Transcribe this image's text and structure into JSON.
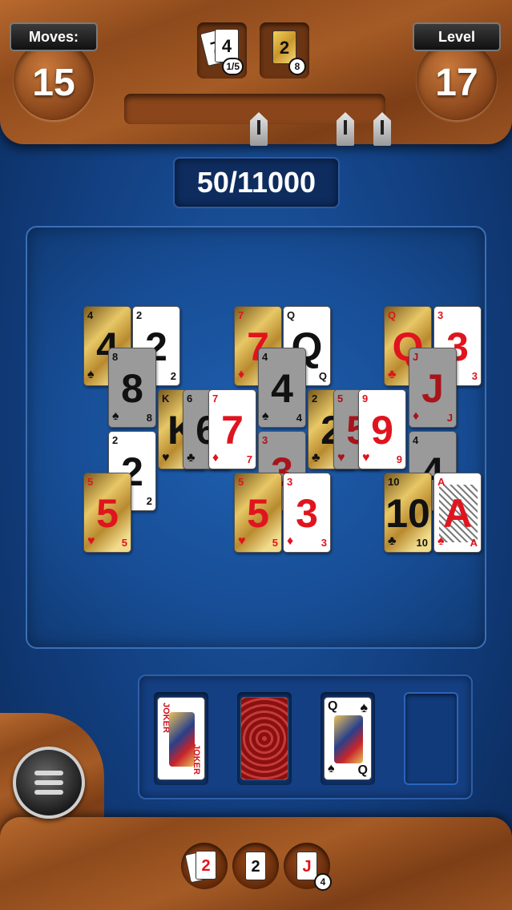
{
  "header": {
    "moves_label": "Moves:",
    "moves_value": "15",
    "level_label": "Level",
    "level_value": "17",
    "combo_card_rank": "4",
    "combo_progress": "1/5",
    "joker_card_rank": "2",
    "joker_count": "8"
  },
  "score": "50/11000",
  "board": {
    "cards": [
      {
        "rank": "4",
        "suit": "♠",
        "style": "gold",
        "color": "black"
      },
      {
        "rank": "2",
        "suit": "♣",
        "style": "face-up",
        "color": "black"
      },
      {
        "rank": "8",
        "suit": "♠",
        "style": "dim",
        "color": "black"
      },
      {
        "rank": "K",
        "suit": "♥",
        "style": "gold",
        "color": "black"
      },
      {
        "rank": "6",
        "suit": "♣",
        "style": "dim",
        "color": "black"
      },
      {
        "rank": "7",
        "suit": "♦",
        "style": "face-up",
        "color": "red"
      },
      {
        "rank": "2",
        "suit": "♣",
        "style": "face-up",
        "color": "black"
      },
      {
        "rank": "5",
        "suit": "♥",
        "style": "gold",
        "color": "red"
      },
      {
        "rank": "7",
        "suit": "♦",
        "style": "gold",
        "color": "red"
      },
      {
        "rank": "Q",
        "suit": "♠",
        "style": "face-up",
        "color": "black"
      },
      {
        "rank": "4",
        "suit": "♠",
        "style": "dim",
        "color": "black"
      },
      {
        "rank": "2",
        "suit": "♣",
        "style": "gold",
        "color": "black"
      },
      {
        "rank": "3",
        "suit": "♦",
        "style": "dim",
        "color": "red"
      },
      {
        "rank": "5",
        "suit": "♥",
        "style": "dim",
        "color": "red"
      },
      {
        "rank": "9",
        "suit": "♥",
        "style": "face-up",
        "color": "red"
      },
      {
        "rank": "5",
        "suit": "♥",
        "style": "gold",
        "color": "red"
      },
      {
        "rank": "3",
        "suit": "♦",
        "style": "face-up",
        "color": "red"
      },
      {
        "rank": "Q",
        "suit": "♣",
        "style": "gold",
        "color": "red"
      },
      {
        "rank": "3",
        "suit": "♦",
        "style": "face-up",
        "color": "red"
      },
      {
        "rank": "J",
        "suit": "♦",
        "style": "dim",
        "color": "red"
      },
      {
        "rank": "4",
        "suit": "♠",
        "style": "dim",
        "color": "black"
      },
      {
        "rank": "10",
        "suit": "♣",
        "style": "gold",
        "color": "black"
      },
      {
        "rank": "A",
        "suit": "♠",
        "style": "face-up",
        "color": "red"
      }
    ]
  },
  "tray": {
    "joker_label": "JOKER",
    "queen_rank": "Q",
    "queen_suit": "♠"
  },
  "bottom": {
    "undo_card": "2",
    "wild_card": "2",
    "jack_card": "J",
    "jack_count": "4"
  },
  "colors": {
    "accent_red": "#e0141e",
    "wood": "#9a5322",
    "table_blue": "#174d95"
  }
}
